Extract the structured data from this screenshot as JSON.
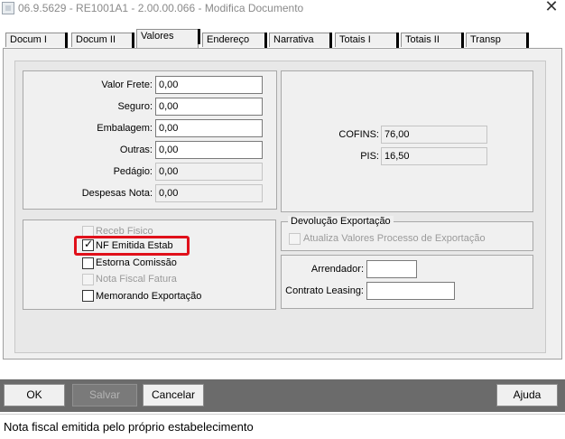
{
  "window": {
    "title": "06.9.5629 - RE1001A1 - 2.00.00.066 - Modifica Documento",
    "close_glyph": "✕"
  },
  "tabs": [
    {
      "label": "Docum I",
      "active": false
    },
    {
      "label": "Docum II",
      "active": false
    },
    {
      "label": "Valores",
      "active": true
    },
    {
      "label": "Endereço",
      "active": false
    },
    {
      "label": "Narrativa",
      "active": false
    },
    {
      "label": "Totais I",
      "active": false
    },
    {
      "label": "Totais II",
      "active": false
    },
    {
      "label": "Transp",
      "active": false
    }
  ],
  "values": {
    "valor_frete": {
      "label": "Valor Frete:",
      "value": "0,00"
    },
    "seguro": {
      "label": "Seguro:",
      "value": "0,00"
    },
    "embalagem": {
      "label": "Embalagem:",
      "value": "0,00"
    },
    "outras": {
      "label": "Outras:",
      "value": "0,00"
    },
    "pedagio": {
      "label": "Pedágio:",
      "value": "0,00"
    },
    "despesas_nota": {
      "label": "Despesas Nota:",
      "value": "0,00"
    }
  },
  "taxes": {
    "cofins": {
      "label": "COFINS:",
      "value": "76,00"
    },
    "pis": {
      "label": "PIS:",
      "value": "16,50"
    }
  },
  "checkboxes": {
    "receb_fisico": {
      "label": "Receb Fisico",
      "checked": false,
      "enabled": false
    },
    "nf_emitida_estab": {
      "label": "NF Emitida Estab",
      "checked": true,
      "enabled": true,
      "mark": "✓"
    },
    "estorna_comissao": {
      "label": "Estorna Comissão",
      "checked": false,
      "enabled": true
    },
    "nota_fiscal_fatura": {
      "label": "Nota Fiscal Fatura",
      "checked": false,
      "enabled": false
    },
    "memorando_exportacao": {
      "label": "Memorando Exportação",
      "checked": false,
      "enabled": true
    }
  },
  "devolucao": {
    "legend": "Devolução Exportação",
    "atualiza_label": "Atualiza Valores Processo de Exportação"
  },
  "leasing": {
    "arrendador_label": "Arrendador:",
    "arrendador_value": "",
    "contrato_label": "Contrato Leasing:",
    "contrato_value": ""
  },
  "buttons": {
    "ok": "OK",
    "salvar": "Salvar",
    "cancelar": "Cancelar",
    "ajuda": "Ajuda"
  },
  "status": "Nota fiscal emitida pelo próprio estabelecimento",
  "colors": {
    "highlight": "#e0101a",
    "button_bar": "#6b6b6b",
    "panel": "#f0f0f0"
  }
}
